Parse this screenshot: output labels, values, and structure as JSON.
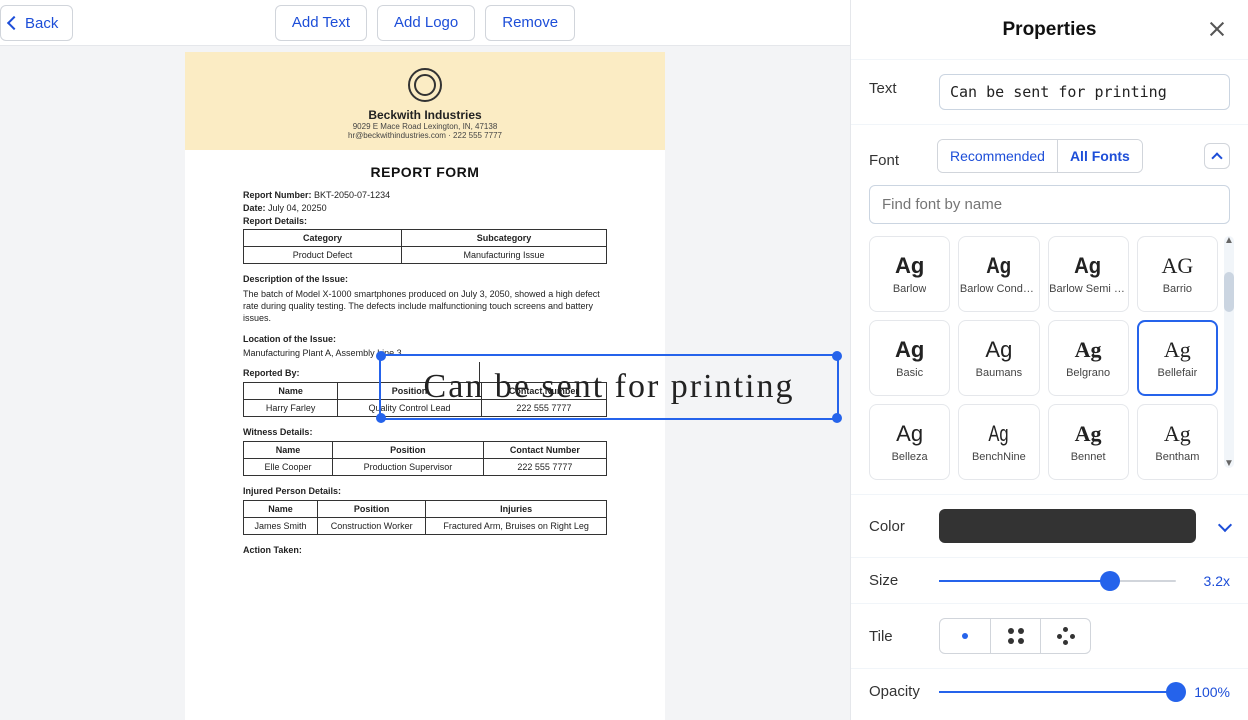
{
  "topbar": {
    "back": "Back",
    "addText": "Add Text",
    "addLogo": "Add Logo",
    "remove": "Remove"
  },
  "doc": {
    "company": "Beckwith Industries",
    "address": "9029 E Mace Road Lexington, IN, 47138",
    "contact": "hr@beckwithindustries.com · 222 555 7777",
    "title": "REPORT FORM",
    "reportNumberLabel": "Report Number:",
    "reportNumber": "BKT-2050-07-1234",
    "dateLabel": "Date:",
    "date": "July 04, 20250",
    "reportDetailsLabel": "Report Details:",
    "categoryHdr": "Category",
    "subcategoryHdr": "Subcategory",
    "category": "Product Defect",
    "subcategory": "Manufacturing Issue",
    "descLabel": "Description of the Issue:",
    "desc": "The batch of Model X-1000 smartphones produced on July 3, 2050, showed a high defect rate during quality testing. The defects include malfunctioning touch screens and battery issues.",
    "locLabel": "Location of the Issue:",
    "loc": "Manufacturing Plant A, Assembly Line 3",
    "reportedByLabel": "Reported By:",
    "nameHdr": "Name",
    "positionHdr": "Position",
    "contactHdr": "Contact Number",
    "rep_name": "Harry Farley",
    "rep_pos": "Quality Control Lead",
    "rep_contact": "222 555 7777",
    "witnessLabel": "Witness Details:",
    "wit_name": "Elle Cooper",
    "wit_pos": "Production Supervisor",
    "wit_contact": "222 555 7777",
    "injuredLabel": "Injured Person Details:",
    "injuriesHdr": "Injuries",
    "inj_name": "James Smith",
    "inj_pos": "Construction Worker",
    "inj_inj": "Fractured Arm, Bruises on Right Leg",
    "actionLabel": "Action Taken:"
  },
  "overlayText": "Can be sent for printing",
  "panel": {
    "title": "Properties",
    "textLabel": "Text",
    "textValue": "Can be sent for printing",
    "fontLabel": "Font",
    "tabRecommended": "Recommended",
    "tabAll": "All Fonts",
    "searchPlaceholder": "Find font by name",
    "fonts": [
      {
        "name": "Barlow",
        "sample": "Ag"
      },
      {
        "name": "Barlow Condensed",
        "sample": "Ag"
      },
      {
        "name": "Barlow Semi Condensed",
        "sample": "Ag"
      },
      {
        "name": "Barrio",
        "sample": "AG"
      },
      {
        "name": "Basic",
        "sample": "Ag"
      },
      {
        "name": "Baumans",
        "sample": "Ag"
      },
      {
        "name": "Belgrano",
        "sample": "Ag"
      },
      {
        "name": "Bellefair",
        "sample": "Ag",
        "selected": true
      },
      {
        "name": "Belleza",
        "sample": "Ag"
      },
      {
        "name": "BenchNine",
        "sample": "Ag"
      },
      {
        "name": "Bennet",
        "sample": "Ag"
      },
      {
        "name": "Bentham",
        "sample": "Ag"
      }
    ],
    "colorLabel": "Color",
    "colorValue": "#333333",
    "sizeLabel": "Size",
    "sizeValue": "3.2x",
    "sizePercent": 72,
    "tileLabel": "Tile",
    "opacityLabel": "Opacity",
    "opacityValue": "100%",
    "opacityPercent": 100
  }
}
